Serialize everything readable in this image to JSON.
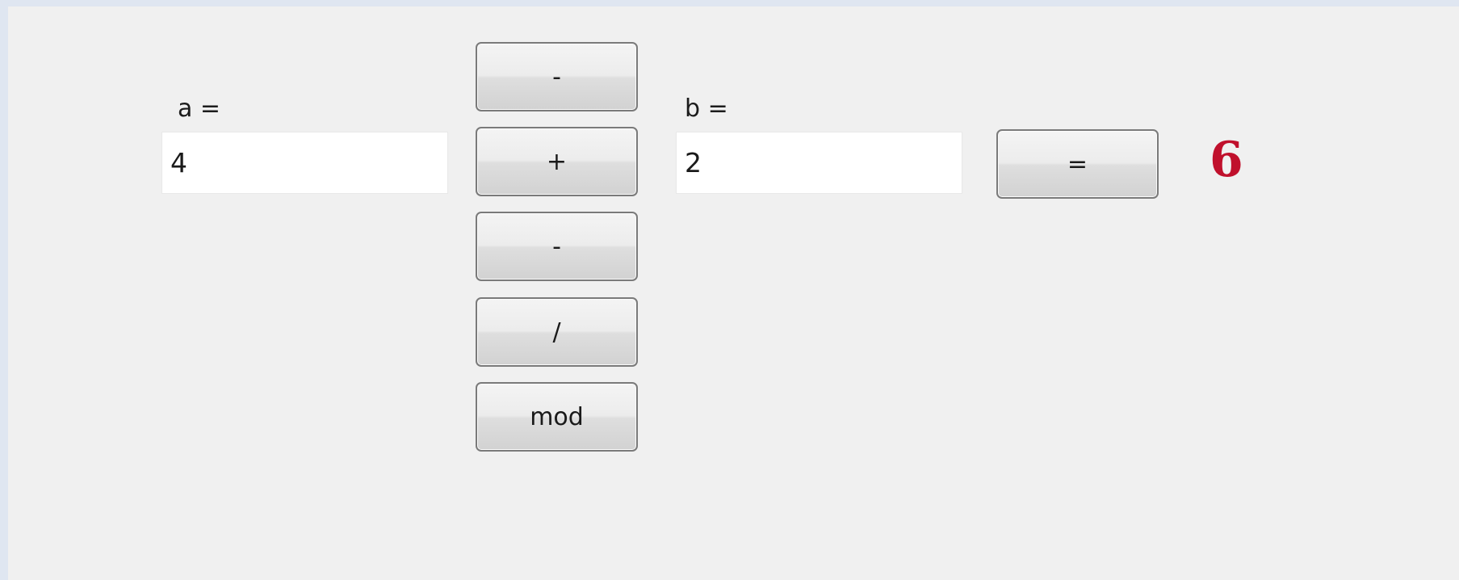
{
  "labels": {
    "a": "a =",
    "b": "b ="
  },
  "inputs": {
    "a_value": "4",
    "b_value": "2"
  },
  "buttons": {
    "top": "-",
    "plus": "+",
    "minus": "-",
    "divide": "/",
    "mod": "mod",
    "equals": "="
  },
  "result": {
    "value": "6",
    "color": "#c0102c"
  }
}
